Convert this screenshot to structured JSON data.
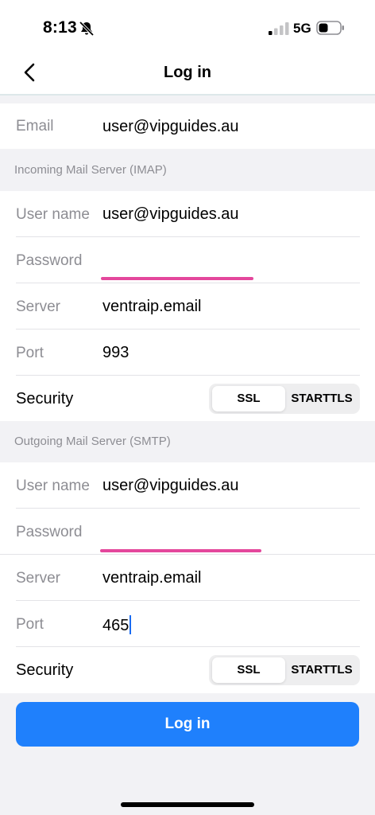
{
  "status_bar": {
    "time": "8:13",
    "network": "5G"
  },
  "nav": {
    "title": "Log in"
  },
  "email": {
    "label": "Email",
    "value": "user@vipguides.au"
  },
  "incoming": {
    "header": "Incoming Mail Server (IMAP)",
    "username_label": "User name",
    "username_value": "user@vipguides.au",
    "password_label": "Password",
    "server_label": "Server",
    "server_value": "ventraip.email",
    "port_label": "Port",
    "port_value": "993",
    "security_label": "Security",
    "security_options": [
      "SSL",
      "STARTTLS"
    ],
    "security_selected": "SSL"
  },
  "outgoing": {
    "header": "Outgoing Mail Server (SMTP)",
    "username_label": "User name",
    "username_value": "user@vipguides.au",
    "password_label": "Password",
    "server_label": "Server",
    "server_value": "ventraip.email",
    "port_label": "Port",
    "port_value": "465",
    "security_label": "Security",
    "security_options": [
      "SSL",
      "STARTTLS"
    ],
    "security_selected": "SSL"
  },
  "login_button": "Log in",
  "colors": {
    "accent": "#1f80fc",
    "highlight": "#e4479c",
    "background": "#f2f2f5"
  }
}
